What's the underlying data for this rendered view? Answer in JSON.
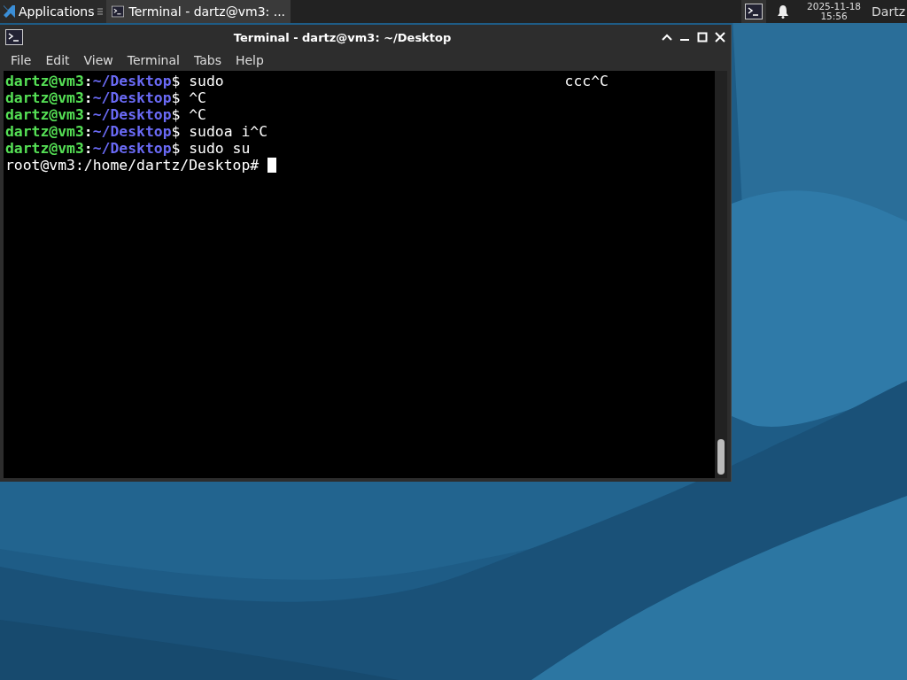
{
  "taskbar": {
    "apps_menu": "Applications",
    "tasks": [
      {
        "label": "Terminal - dartz@vm3: ...",
        "selected": true
      }
    ],
    "clock": {
      "date": "2025-11-18",
      "time": "15:56"
    },
    "user": "Dartz"
  },
  "window": {
    "title": "Terminal - dartz@vm3: ~/Desktop",
    "menu": [
      "File",
      "Edit",
      "View",
      "Terminal",
      "Tabs",
      "Help"
    ],
    "lines": [
      {
        "kind": "prompt",
        "user": "dartz@vm3",
        "sep": ":",
        "path": "~/Desktop",
        "sign": "$",
        "command": " sudo",
        "trailing": "ccc^C"
      },
      {
        "kind": "prompt",
        "user": "dartz@vm3",
        "sep": ":",
        "path": "~/Desktop",
        "sign": "$",
        "command": " ^C"
      },
      {
        "kind": "prompt",
        "user": "dartz@vm3",
        "sep": ":",
        "path": "~/Desktop",
        "sign": "$",
        "command": " ^C"
      },
      {
        "kind": "prompt",
        "user": "dartz@vm3",
        "sep": ":",
        "path": "~/Desktop",
        "sign": "$",
        "command": " sudoa i^C"
      },
      {
        "kind": "prompt",
        "user": "dartz@vm3",
        "sep": ":",
        "path": "~/Desktop",
        "sign": "$",
        "command": " sudo su"
      },
      {
        "kind": "root",
        "text": "root@vm3:/home/dartz/Desktop#",
        "cursor": true
      }
    ]
  }
}
